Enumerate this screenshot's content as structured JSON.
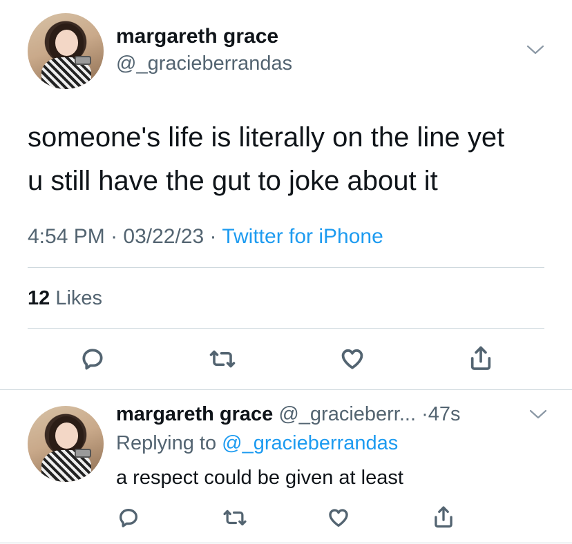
{
  "main_tweet": {
    "display_name": "margareth grace",
    "handle": "@_gracieberrandas",
    "text_line1": "someone's life is literally on the line yet",
    "text_line2": "u still have the gut to joke about it",
    "time": "4:54 PM",
    "date": "03/22/23",
    "separator": "·",
    "source": "Twitter for iPhone",
    "likes_count": "12",
    "likes_label": "Likes"
  },
  "reply_tweet": {
    "display_name": "margareth grace",
    "handle": "@_gracieberr...",
    "separator": "·",
    "time_ago": "47s",
    "replying_prefix": "Replying to",
    "replying_handle": "@_gracieberrandas",
    "text": "a respect could be given at least"
  },
  "icons": {
    "reply": "reply-icon",
    "retweet": "retweet-icon",
    "like": "heart-icon",
    "share": "share-icon",
    "more": "chevron-down-icon"
  },
  "colors": {
    "text_primary": "#0f1419",
    "text_secondary": "#536471",
    "link": "#1d9bf0",
    "divider": "#cfd9de"
  }
}
